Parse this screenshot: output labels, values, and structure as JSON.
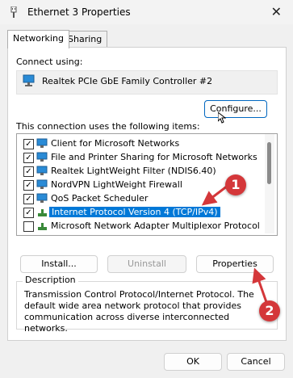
{
  "window": {
    "title": "Ethernet 3 Properties",
    "close_glyph": "✕"
  },
  "tabs": [
    {
      "label": "Networking",
      "active": true
    },
    {
      "label": "Sharing",
      "active": false
    }
  ],
  "connect_using": {
    "label": "Connect using:",
    "adapter": "Realtek PCIe GbE Family Controller #2"
  },
  "buttons": {
    "configure": "Configure...",
    "install": "Install...",
    "uninstall": "Uninstall",
    "properties": "Properties",
    "ok": "OK",
    "cancel": "Cancel"
  },
  "items_label": "This connection uses the following items:",
  "items": [
    {
      "label": "Client for Microsoft Networks",
      "checked": true,
      "icon": "network-client-icon"
    },
    {
      "label": "File and Printer Sharing for Microsoft Networks",
      "checked": true,
      "icon": "network-service-icon"
    },
    {
      "label": "Realtek LightWeight Filter (NDIS6.40)",
      "checked": true,
      "icon": "network-filter-icon"
    },
    {
      "label": "NordVPN LightWeight Firewall",
      "checked": true,
      "icon": "network-filter-icon"
    },
    {
      "label": "QoS Packet Scheduler",
      "checked": true,
      "icon": "network-service-icon"
    },
    {
      "label": "Internet Protocol Version 4 (TCP/IPv4)",
      "checked": true,
      "icon": "protocol-icon",
      "selected": true
    },
    {
      "label": "Microsoft Network Adapter Multiplexor Protocol",
      "checked": false,
      "icon": "protocol-icon"
    }
  ],
  "description": {
    "label": "Description",
    "text": "Transmission Control Protocol/Internet Protocol. The default wide area network protocol that provides communication across diverse interconnected networks."
  },
  "annotations": [
    {
      "number": "1"
    },
    {
      "number": "2"
    }
  ],
  "colors": {
    "accent": "#0078d7",
    "annotation": "#d4373a"
  }
}
